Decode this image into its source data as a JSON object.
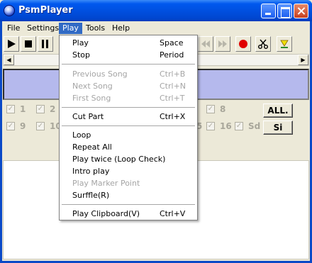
{
  "window": {
    "title": "PsmPlayer"
  },
  "menubar": {
    "items": [
      "File",
      "Settings",
      "Play",
      "Tools",
      "Help"
    ],
    "open": "Play"
  },
  "toolbar": {
    "icons": [
      "play-icon",
      "stop-icon",
      "pause-icon",
      "skip-back-icon",
      "skip-forward-icon",
      "record-icon",
      "scissors-icon",
      "marker-icon"
    ]
  },
  "checks": {
    "row1": [
      "1",
      "2",
      "8"
    ],
    "row2": [
      "9",
      "10",
      "5",
      "16",
      "Sd"
    ],
    "all_label": "ALL.",
    "si_label": "Si"
  },
  "play_menu": {
    "items": [
      {
        "label": "Play",
        "shortcut": "Space",
        "enabled": true
      },
      {
        "label": "Stop",
        "shortcut": "Period",
        "enabled": true
      },
      {
        "label": "Previous Song",
        "shortcut": "Ctrl+B",
        "enabled": false
      },
      {
        "label": "Next Song",
        "shortcut": "Ctrl+N",
        "enabled": false
      },
      {
        "label": "First Song",
        "shortcut": "Ctrl+T",
        "enabled": false
      },
      {
        "label": "Cut Part",
        "shortcut": "Ctrl+X",
        "enabled": true
      },
      {
        "label": "Loop",
        "shortcut": "",
        "enabled": true
      },
      {
        "label": "Repeat All",
        "shortcut": "",
        "enabled": true
      },
      {
        "label": "Play twice (Loop Check)",
        "shortcut": "",
        "enabled": true
      },
      {
        "label": "Intro play",
        "shortcut": "",
        "enabled": true
      },
      {
        "label": "Play Marker Point",
        "shortcut": "",
        "enabled": false
      },
      {
        "label": "Surffle(R)",
        "shortcut": "",
        "enabled": true
      },
      {
        "label": "Play Clipboard(V)",
        "shortcut": "Ctrl+V",
        "enabled": true
      }
    ]
  },
  "colors": {
    "titlebar": "#0058ee",
    "menu_highlight": "#316ac5",
    "display": "#b5b9ed",
    "record": "#e00000"
  }
}
